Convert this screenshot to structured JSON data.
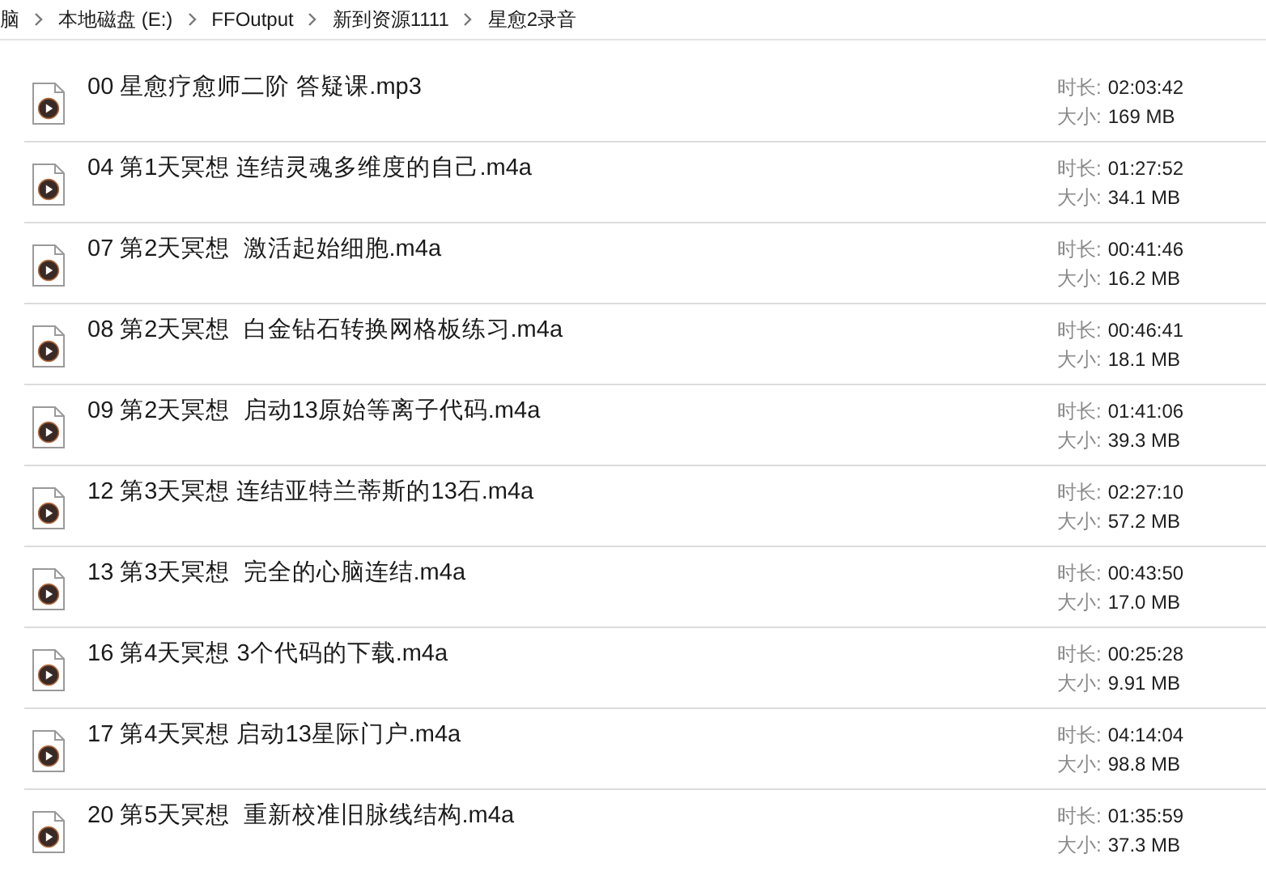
{
  "breadcrumb": [
    {
      "label": "脑"
    },
    {
      "label": "本地磁盘 (E:)"
    },
    {
      "label": "FFOutput"
    },
    {
      "label": "新到资源1111"
    },
    {
      "label": "星愈2录音"
    }
  ],
  "files": [
    {
      "name": "00 星愈疗愈师二阶 答疑课.mp3",
      "duration_label": "时长:",
      "duration": "02:03:42",
      "size_label": "大小:",
      "size": "169 MB"
    },
    {
      "name": "04 第1天冥想 连结灵魂多维度的自己.m4a",
      "duration_label": "时长:",
      "duration": "01:27:52",
      "size_label": "大小:",
      "size": "34.1 MB"
    },
    {
      "name": "07 第2天冥想  激活起始细胞.m4a",
      "duration_label": "时长:",
      "duration": "00:41:46",
      "size_label": "大小:",
      "size": "16.2 MB"
    },
    {
      "name": "08 第2天冥想  白金钻石转换网格板练习.m4a",
      "duration_label": "时长:",
      "duration": "00:46:41",
      "size_label": "大小:",
      "size": "18.1 MB"
    },
    {
      "name": "09 第2天冥想  启动13原始等离子代码.m4a",
      "duration_label": "时长:",
      "duration": "01:41:06",
      "size_label": "大小:",
      "size": "39.3 MB"
    },
    {
      "name": "12 第3天冥想 连结亚特兰蒂斯的13石.m4a",
      "duration_label": "时长:",
      "duration": "02:27:10",
      "size_label": "大小:",
      "size": "57.2 MB"
    },
    {
      "name": "13 第3天冥想  完全的心脑连结.m4a",
      "duration_label": "时长:",
      "duration": "00:43:50",
      "size_label": "大小:",
      "size": "17.0 MB"
    },
    {
      "name": "16 第4天冥想 3个代码的下载.m4a",
      "duration_label": "时长:",
      "duration": "00:25:28",
      "size_label": "大小:",
      "size": "9.91 MB"
    },
    {
      "name": "17 第4天冥想 启动13星际门户.m4a",
      "duration_label": "时长:",
      "duration": "04:14:04",
      "size_label": "大小:",
      "size": "98.8 MB"
    },
    {
      "name": "20 第5天冥想  重新校准旧脉线结构.m4a",
      "duration_label": "时长:",
      "duration": "01:35:59",
      "size_label": "大小:",
      "size": "37.3 MB"
    }
  ]
}
